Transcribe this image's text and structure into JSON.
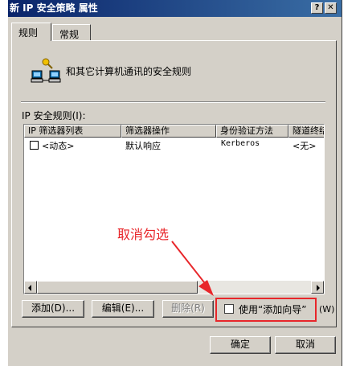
{
  "window": {
    "title": "新 IP 安全策略 属性",
    "help_btn": "?",
    "close_btn": "✕"
  },
  "tabs": [
    {
      "label": "规则",
      "active": true
    },
    {
      "label": "常规",
      "active": false
    }
  ],
  "description": "和其它计算机通讯的安全规则",
  "rules_label": "IP 安全规则(I):",
  "list": {
    "columns": [
      "IP 筛选器列表",
      "筛选器操作",
      "身份验证方法",
      "隧道终结点"
    ],
    "rows": [
      {
        "checked": false,
        "filter_list": "<动态>",
        "action": "默认响应",
        "auth": "Kerberos",
        "tunnel": "<无>"
      }
    ]
  },
  "buttons": {
    "add": "添加(D)...",
    "edit": "编辑(E)...",
    "remove": "删除(R)",
    "use_wizard": "使用“添加向导”",
    "use_wizard_accel": "(W)",
    "ok": "确定",
    "cancel": "取消"
  },
  "annotation": {
    "text": "取消勾选",
    "color": "#e8262a"
  },
  "colors": {
    "dialog_bg": "#d4d0c8",
    "title_start": "#0a246a",
    "title_end": "#3a6ea5"
  }
}
